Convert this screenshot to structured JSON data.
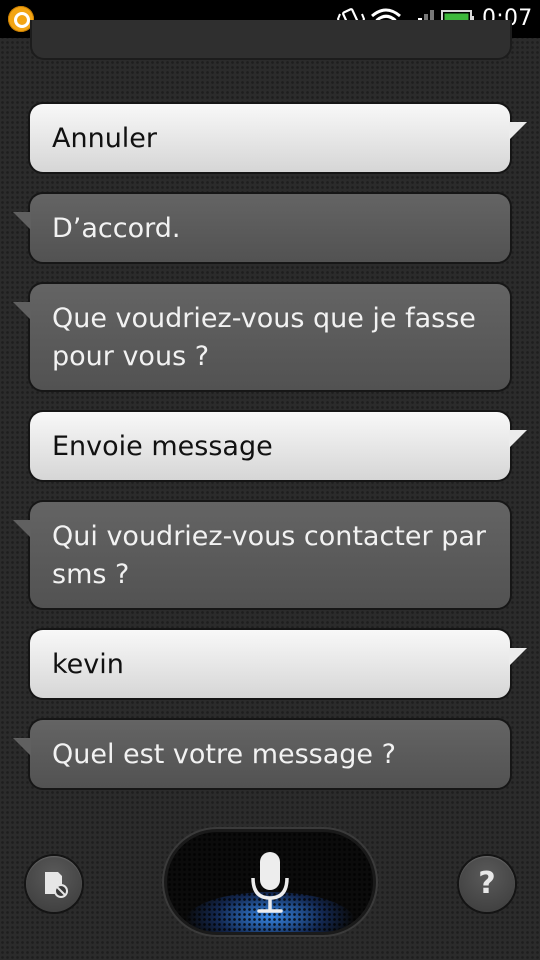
{
  "status_bar": {
    "time": "0:07",
    "icons": [
      "notification-icon",
      "vibrate-icon",
      "wifi-icon",
      "signal-icon",
      "battery-icon"
    ],
    "battery_color": "#3db83b"
  },
  "conversation": {
    "messages": [
      {
        "sender": "user",
        "text": "Annuler"
      },
      {
        "sender": "assistant",
        "text": "D’accord."
      },
      {
        "sender": "assistant",
        "text": "Que voudriez-vous que je fasse pour vous ?"
      },
      {
        "sender": "user",
        "text": "Envoie message"
      },
      {
        "sender": "assistant",
        "text": "Qui voudriez-vous contacter par sms ?"
      },
      {
        "sender": "user",
        "text": "kevin"
      },
      {
        "sender": "assistant",
        "text": "Quel est votre message ?"
      }
    ]
  },
  "controls": {
    "left_icon": "settings-card-icon",
    "center_icon": "microphone-icon",
    "help_label": "?",
    "mic_glow_color": "#3c96ff"
  }
}
